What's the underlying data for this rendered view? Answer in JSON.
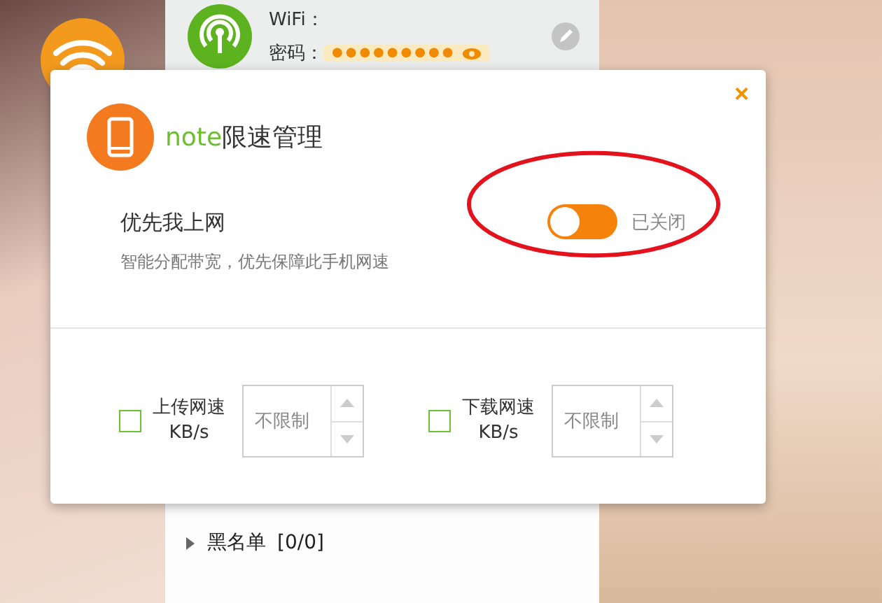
{
  "wifi_panel": {
    "wifi_label": "WiFi：",
    "password_label": "密码：",
    "password_mask": "●●●●●●●●●",
    "groups": [
      {
        "label": "黑名单",
        "count": "[0/0]",
        "expanded": false
      }
    ]
  },
  "dialog": {
    "close_glyph": "×",
    "device_name": "note",
    "title_suffix": "限速管理",
    "priority": {
      "label": "优先我上网",
      "description": "智能分配带宽，优先保障此手机网速",
      "on": false,
      "status": "已关闭"
    },
    "limits": [
      {
        "label": "上传网速",
        "unit": "KB/s",
        "checked": false,
        "value": "不限制"
      },
      {
        "label": "下载网速",
        "unit": "KB/s",
        "checked": false,
        "value": "不限制"
      }
    ]
  },
  "annotations": [
    {
      "kind": "ellipse",
      "color": "#e3121c"
    }
  ]
}
